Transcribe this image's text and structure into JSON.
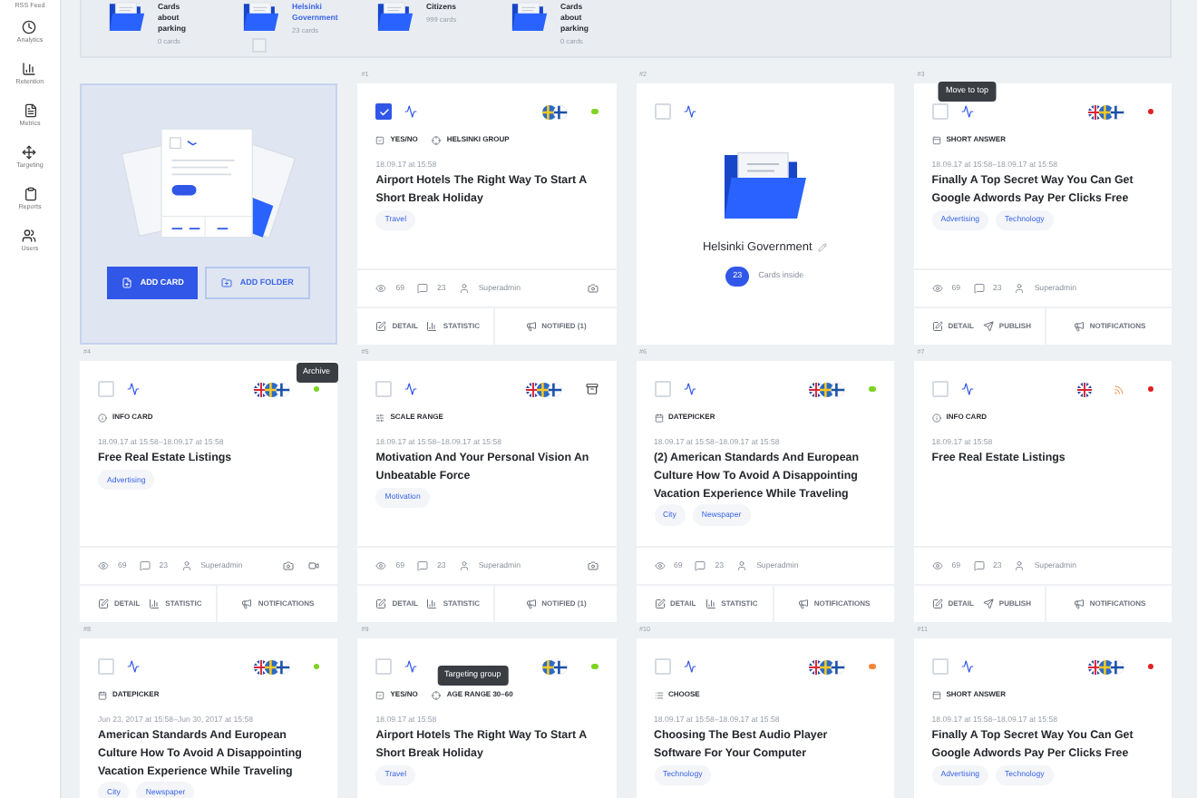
{
  "sidebar": {
    "items": [
      {
        "label": "RSS Feed"
      },
      {
        "label": "Analytics"
      },
      {
        "label": "Retention"
      },
      {
        "label": "Metrics"
      },
      {
        "label": "Targeting"
      },
      {
        "label": "Reports"
      },
      {
        "label": "Users"
      }
    ]
  },
  "folders": [
    {
      "name": "Cards about parking",
      "count": "0 cards",
      "selected": false
    },
    {
      "name": "Helsinki Government",
      "count": "23 cards",
      "selected": true,
      "checkbox": {
        "checked": false
      }
    },
    {
      "name": "Citizens",
      "count": "999 cards",
      "selected": false
    },
    {
      "name": "Cards about parking",
      "count": "0 cards",
      "selected": false
    }
  ],
  "add_panel": {
    "buttons": [
      {
        "label": "ADD CARD",
        "kind": "primary"
      },
      {
        "label": "ADD FOLDER",
        "kind": "secondary"
      }
    ]
  },
  "cards": [
    {
      "number": "#1",
      "kind": "card",
      "checked": true,
      "flags": [
        {
          "kind": "se"
        },
        {
          "kind": "fi"
        }
      ],
      "status": {
        "kind": "dot",
        "color": "#7ed321"
      },
      "types": [
        {
          "kind": "yesno",
          "label": "YES/NO"
        },
        {
          "kind": "target",
          "label": "HELSINKI GROUP"
        }
      ],
      "date": "18.09.17 at 15:58",
      "title": "Airport Hotels The Right Way To Start A Short Break Holiday",
      "tags": [
        "Travel"
      ],
      "stats": {
        "views": "69",
        "comments": "23",
        "author": "Superadmin",
        "media": [
          {
            "kind": "camera"
          }
        ]
      },
      "actions": [
        {
          "kind": "detail",
          "label": "DETAIL"
        },
        {
          "kind": "statistic",
          "label": "STATISTIC"
        },
        {
          "kind": "megaphone",
          "label": "NOTIFIED (1)"
        }
      ]
    },
    {
      "number": "#2",
      "kind": "folder",
      "checked": false,
      "name": "Helsinki Government",
      "count": "23",
      "count_label": "Cards inside"
    },
    {
      "number": "#3",
      "kind": "card",
      "checked": false,
      "flags": [
        {
          "kind": "uk"
        },
        {
          "kind": "se"
        },
        {
          "kind": "fi"
        }
      ],
      "status": {
        "kind": "dot",
        "color": "#e02020"
      },
      "tooltip": {
        "text": "Move to top",
        "kind": "trend"
      },
      "types": [
        {
          "kind": "short",
          "label": "SHORT ANSWER"
        }
      ],
      "date": "18.09.17 at 15:58–18.09.17 at 15:58",
      "title": "Finally A Top Secret Way You Can Get Google Adwords Pay Per Clicks Free",
      "tags": [
        "Advertising",
        "Technology"
      ],
      "stats": {
        "views": "69",
        "comments": "23",
        "author": "Superadmin"
      },
      "actions": [
        {
          "kind": "detail",
          "label": "DETAIL"
        },
        {
          "kind": "publish",
          "label": "PUBLISH"
        },
        {
          "kind": "megaphone",
          "label": "NOTIFICATIONS"
        }
      ]
    },
    {
      "number": "#4",
      "kind": "card",
      "checked": false,
      "flags": [
        {
          "kind": "uk"
        },
        {
          "kind": "se"
        },
        {
          "kind": "fi"
        }
      ],
      "status": {
        "kind": "dot",
        "color": "#7ed321"
      },
      "tooltip": {
        "text": "Archive",
        "kind": "status"
      },
      "types": [
        {
          "kind": "info",
          "label": "INFO CARD"
        }
      ],
      "date": "18.09.17 at 15:58–18.09.17 at 15:58",
      "title": "Free Real Estate Listings",
      "tags": [
        "Advertising"
      ],
      "stats": {
        "views": "69",
        "comments": "23",
        "author": "Superadmin",
        "media": [
          {
            "kind": "camera"
          },
          {
            "kind": "video"
          }
        ]
      },
      "actions": [
        {
          "kind": "detail",
          "label": "DETAIL"
        },
        {
          "kind": "statistic",
          "label": "STATISTIC"
        },
        {
          "kind": "megaphone",
          "label": "NOTIFICATIONS"
        }
      ]
    },
    {
      "number": "#5",
      "kind": "card",
      "checked": false,
      "flags": [
        {
          "kind": "uk"
        },
        {
          "kind": "se"
        },
        {
          "kind": "fi"
        }
      ],
      "status": {
        "kind": "archive"
      },
      "types": [
        {
          "kind": "scale",
          "label": "SCALE RANGE"
        }
      ],
      "date": "18.09.17 at 15:58–18.09.17 at 15:58",
      "title": "Motivation And Your Personal Vision An Unbeatable Force",
      "tags": [
        "Motivation"
      ],
      "stats": {
        "views": "69",
        "comments": "23",
        "author": "Superadmin",
        "media": [
          {
            "kind": "camera"
          }
        ]
      },
      "actions": [
        {
          "kind": "detail",
          "label": "DETAIL"
        },
        {
          "kind": "statistic",
          "label": "STATISTIC"
        },
        {
          "kind": "megaphone",
          "label": "NOTIFIED (1)"
        }
      ]
    },
    {
      "number": "#6",
      "kind": "card",
      "checked": false,
      "flags": [
        {
          "kind": "uk"
        },
        {
          "kind": "se"
        },
        {
          "kind": "fi"
        }
      ],
      "status": {
        "kind": "dot",
        "color": "#7ed321"
      },
      "types": [
        {
          "kind": "date",
          "label": "DATEPICKER"
        }
      ],
      "date": "18.09.17 at 15:58–18.09.17 at 15:58",
      "title": "(2) American Standards And European Culture How To Avoid A Disappointing Vacation Experience While Traveling",
      "tags": [
        "City",
        "Newspaper"
      ],
      "stats": {
        "views": "69",
        "comments": "23",
        "author": "Superadmin"
      },
      "actions": [
        {
          "kind": "detail",
          "label": "DETAIL"
        },
        {
          "kind": "statistic",
          "label": "STATISTIC"
        },
        {
          "kind": "megaphone",
          "label": "NOTIFICATIONS"
        }
      ]
    },
    {
      "number": "#7",
      "kind": "card",
      "checked": false,
      "flags": [
        {
          "kind": "uk"
        }
      ],
      "rss": true,
      "status": {
        "kind": "dot",
        "color": "#e02020"
      },
      "types": [
        {
          "kind": "info",
          "label": "INFO CARD"
        }
      ],
      "date": "18.09.17 at 15:58",
      "title": "Free Real Estate Listings",
      "stats": {
        "views": "69",
        "comments": "23",
        "author": "Superadmin"
      },
      "actions": [
        {
          "kind": "detail",
          "label": "DETAIL"
        },
        {
          "kind": "publish",
          "label": "PUBLISH"
        },
        {
          "kind": "megaphone",
          "label": "NOTIFICATIONS"
        }
      ]
    },
    {
      "number": "#8",
      "kind": "card",
      "checked": false,
      "flags": [
        {
          "kind": "uk"
        },
        {
          "kind": "se"
        },
        {
          "kind": "fi"
        }
      ],
      "status": {
        "kind": "dot",
        "color": "#7ed321"
      },
      "types": [
        {
          "kind": "date",
          "label": "DATEPICKER"
        }
      ],
      "date": "Jun 23, 2017 at 15:58–Jun 30, 2017 at 15:58",
      "title": "American Standards And European Culture How To Avoid A Disappointing Vacation Experience While Traveling",
      "tags": [
        "City",
        "Newspaper"
      ]
    },
    {
      "number": "#9",
      "kind": "card",
      "checked": false,
      "flags": [
        {
          "kind": "se"
        },
        {
          "kind": "fi"
        }
      ],
      "status": {
        "kind": "dot",
        "color": "#7ed321"
      },
      "tooltip": {
        "text": "Targeting group",
        "kind": "type"
      },
      "types": [
        {
          "kind": "yesno",
          "label": "YES/NO"
        },
        {
          "kind": "target",
          "label": "AGE RANGE 30–60"
        }
      ],
      "date": "18.09.17 at 15:58",
      "title": "Airport Hotels The Right Way To Start A Short Break Holiday",
      "tags": [
        "Travel"
      ]
    },
    {
      "number": "#10",
      "kind": "card",
      "checked": false,
      "flags": [
        {
          "kind": "uk"
        },
        {
          "kind": "se"
        },
        {
          "kind": "fi"
        }
      ],
      "status": {
        "kind": "dot",
        "color": "#f5873a"
      },
      "types": [
        {
          "kind": "choose",
          "label": "CHOOSE"
        }
      ],
      "date": "18.09.17 at 15:58–18.09.17 at 15:58",
      "title": "Choosing The Best Audio Player Software For Your Computer",
      "tags": [
        "Technology"
      ]
    },
    {
      "number": "#11",
      "kind": "card",
      "checked": false,
      "flags": [
        {
          "kind": "uk"
        },
        {
          "kind": "se"
        },
        {
          "kind": "fi"
        }
      ],
      "status": {
        "kind": "dot",
        "color": "#e02020"
      },
      "types": [
        {
          "kind": "short",
          "label": "SHORT ANSWER"
        }
      ],
      "date": "18.09.17 at 15:58–18.09.17 at 15:58",
      "title": "Finally A Top Secret Way You Can Get Google Adwords Pay Per Clicks Free",
      "tags": [
        "Advertising",
        "Technology"
      ]
    }
  ]
}
